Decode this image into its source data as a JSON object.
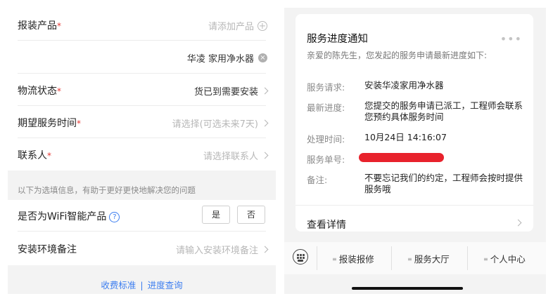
{
  "form": {
    "product": {
      "label": "报装产品",
      "required": "*",
      "placeholder": "请添加产品"
    },
    "product_item": {
      "value": "华凌 家用净水器"
    },
    "logistics": {
      "label": "物流状态",
      "required": "*",
      "value": "货已到需要安装"
    },
    "service_time": {
      "label": "期望服务时间",
      "required": "*",
      "placeholder": "请选择(可选未来7天)"
    },
    "contact": {
      "label": "联系人",
      "required": "*",
      "placeholder": "请选择联系人"
    },
    "optional_hint": "以下为选填信息，有助于更好更快地解决您的问题",
    "wifi": {
      "label": "是否为WiFi智能产品",
      "help": "?",
      "yes": "是",
      "no": "否"
    },
    "env_note": {
      "label": "安装环境备注",
      "placeholder": "请输入安装环境备注"
    },
    "footer": {
      "fee_link": "收费标准",
      "separator": "|",
      "progress_link": "进度查询"
    }
  },
  "notice": {
    "title": "服务进度通知",
    "more": "•••",
    "greeting": "亲爱的陈先生，您发起的服务申请最新进度如下:",
    "request_label": "服务请求:",
    "request_value": "安装华凌家用净水器",
    "progress_label": "最新进度:",
    "progress_value": "您提交的服务申请已派工，工程师会联系您预约具体服务时间",
    "time_label": "处理时间:",
    "time_value": "10月24日 14:16:07",
    "order_label": "服务单号:",
    "remark_label": "备注:",
    "remark_value": "不要忘记我们的约定，工程师会按时提供服务哦",
    "detail_link": "查看详情"
  },
  "tabbar": {
    "tabs": [
      "报装报修",
      "服务大厅",
      "个人中心"
    ]
  },
  "colors": {
    "accent": "#3d7ef0",
    "required": "#e53935",
    "redaction": "#e8222c"
  }
}
